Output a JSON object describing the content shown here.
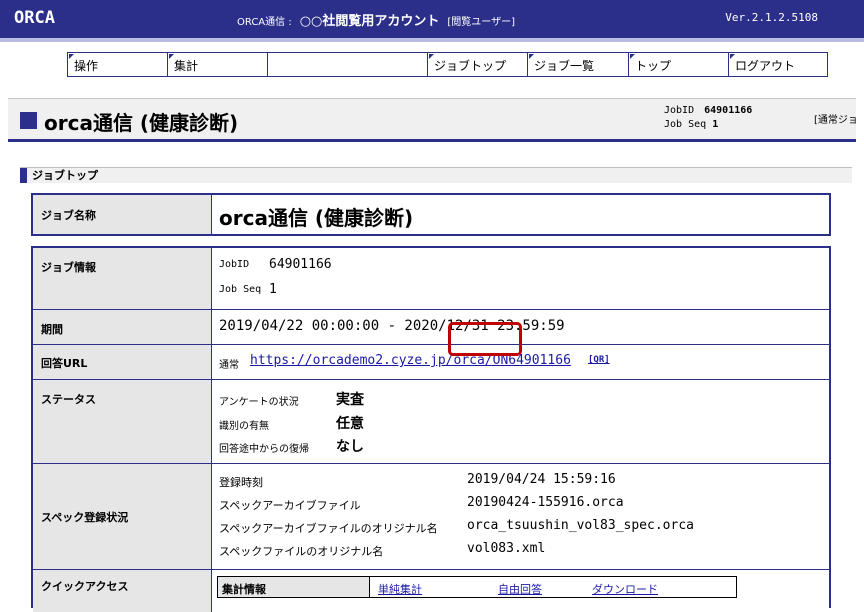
{
  "header": {
    "logo": "ORCA",
    "service": "ORCA通信 :",
    "account": "○○社閲覧用アカウント",
    "role": "[閲覧ユーザー]",
    "version": "Ver.2.1.2.5108"
  },
  "menu": {
    "items": [
      {
        "label": "操作"
      },
      {
        "label": "集計"
      },
      {
        "label": ""
      },
      {
        "label": "ジョブトップ"
      },
      {
        "label": "ジョブ一覧"
      },
      {
        "label": "トップ"
      },
      {
        "label": "ログアウト"
      }
    ]
  },
  "title_panel": {
    "title": "orca通信 (健康診断)",
    "jobid_label": "JobID",
    "jobid_value": "64901166",
    "jobseq_label": "Job Seq",
    "jobseq_value": "1",
    "cut_text": "[通常ジョ"
  },
  "section": {
    "heading": "ジョブトップ"
  },
  "job_name": {
    "label": "ジョブ名称",
    "value": "orca通信 (健康診断)"
  },
  "info": {
    "job_info_label": "ジョブ情報",
    "jobid_label": "JobID",
    "jobid_value": "64901166",
    "jobseq_label": "Job Seq",
    "jobseq_value": "1",
    "period_label": "期間",
    "period_value": "2019/04/22 00:00:00 - 2020/12/31 23:59:59",
    "url_label": "回答URL",
    "url_prefix": "通常",
    "url_value": "https://orcademo2.cyze.jp/orca/ON64901166",
    "qr_label": "[QR]",
    "status_label": "ステータス",
    "status": [
      {
        "name": "アンケートの状況",
        "value": "実査"
      },
      {
        "name": "識別の有無",
        "value": "任意"
      },
      {
        "name": "回答途中からの復帰",
        "value": "なし"
      }
    ],
    "spec_label": "スペック登録状況",
    "spec": [
      {
        "name": "登録時刻",
        "value": "2019/04/24 15:59:16"
      },
      {
        "name": "スペックアーカイブファイル",
        "value": "20190424-155916.orca"
      },
      {
        "name": "スペックアーカイブファイルのオリジナル名",
        "value": "orca_tsuushin_vol83_spec.orca"
      },
      {
        "name": "スペックファイルのオリジナル名",
        "value": "vol083.xml"
      }
    ],
    "quick_label": "クイックアクセス",
    "quick_header": "集計情報",
    "quick_links": [
      {
        "label": "単純集計"
      },
      {
        "label": "自由回答"
      },
      {
        "label": "ダウンロード"
      }
    ]
  }
}
